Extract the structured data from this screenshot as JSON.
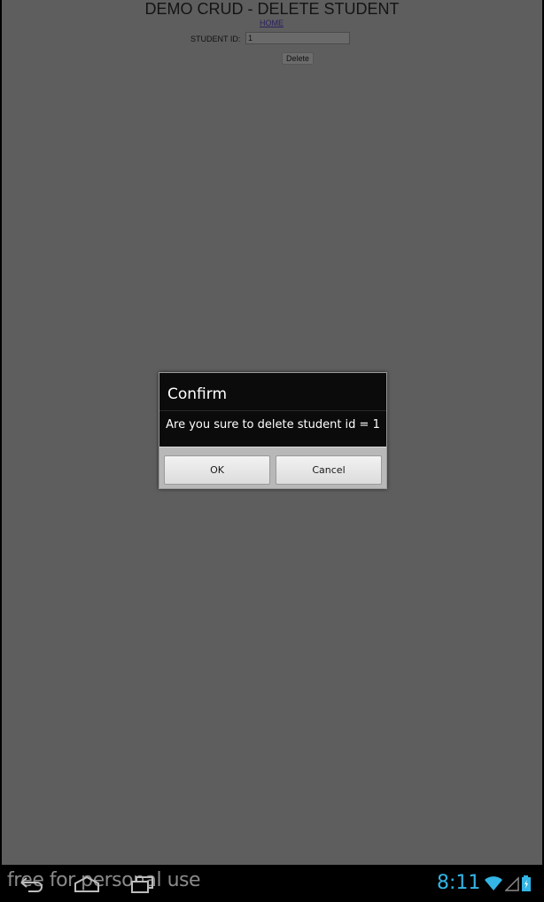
{
  "page": {
    "title": "DEMO CRUD - DELETE STUDENT",
    "home_link": "HOME",
    "student_id_label": "STUDENT ID:",
    "student_id_value": "1",
    "delete_label": "Delete"
  },
  "dialog": {
    "title": "Confirm",
    "message": "Are you sure to delete student id = 1",
    "ok_label": "OK",
    "cancel_label": "Cancel"
  },
  "nav": {
    "watermark": "free for personal use",
    "clock": "8:11",
    "icons": [
      "back-icon",
      "home-icon",
      "recent-apps-icon"
    ],
    "status_icons": [
      "wifi-icon",
      "signal-icon",
      "battery-icon"
    ]
  },
  "colors": {
    "background": "#5e5e5e",
    "accent": "#33b5e5"
  }
}
